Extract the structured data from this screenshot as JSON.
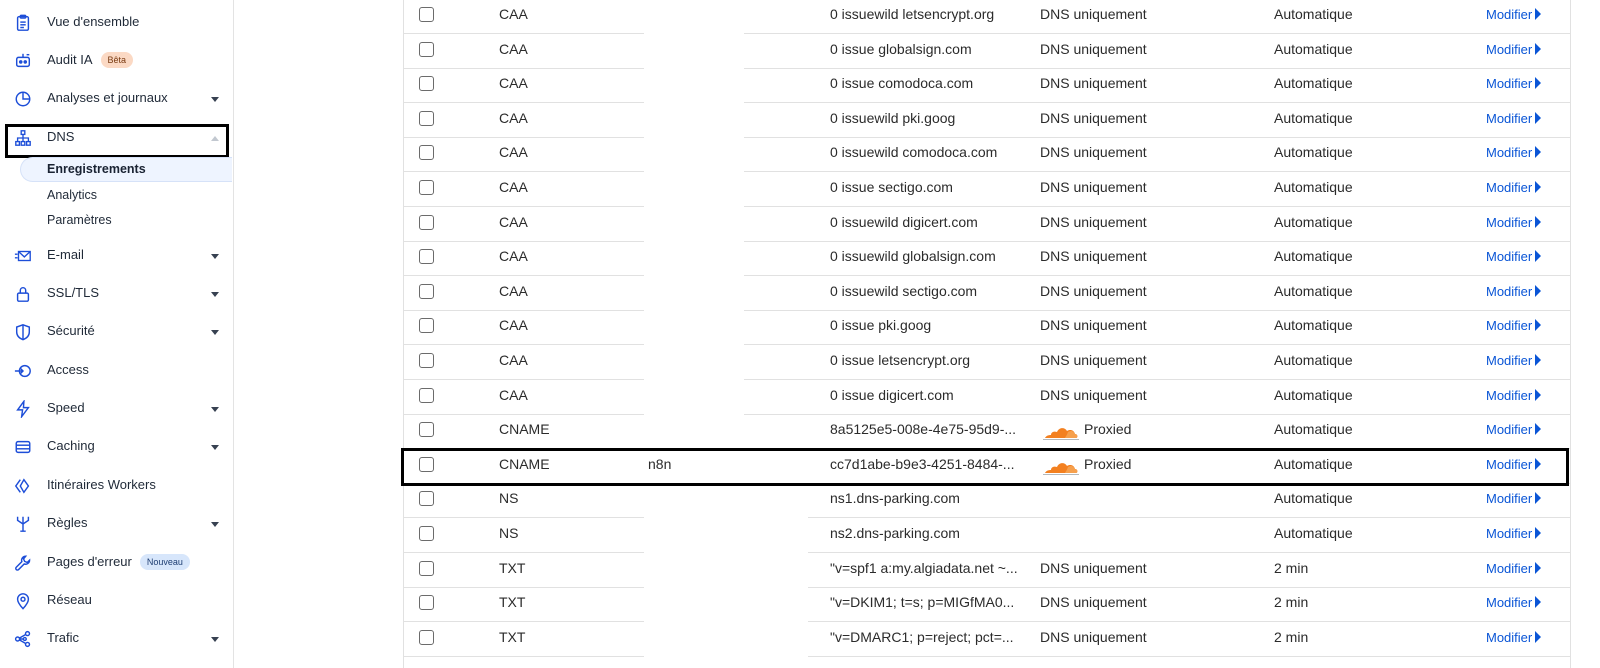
{
  "sidebar": {
    "items": [
      {
        "label": "Vue d'ensemble",
        "icon": "clipboard-icon"
      },
      {
        "label": "Audit IA",
        "icon": "robot-icon",
        "badge": "Bêta"
      },
      {
        "label": "Analyses et journaux",
        "icon": "pie-chart-icon"
      },
      {
        "label": "DNS",
        "icon": "network-tree-icon"
      },
      {
        "label": "E-mail",
        "icon": "envelope-icon"
      },
      {
        "label": "SSL/TLS",
        "icon": "lock-icon"
      },
      {
        "label": "Sécurité",
        "icon": "shield-icon"
      },
      {
        "label": "Access",
        "icon": "access-icon"
      },
      {
        "label": "Speed",
        "icon": "lightning-icon"
      },
      {
        "label": "Caching",
        "icon": "storage-icon"
      },
      {
        "label": "Itinéraires Workers",
        "icon": "workers-icon"
      },
      {
        "label": "Règles",
        "icon": "rules-fork-icon"
      },
      {
        "label": "Pages d'erreur",
        "icon": "wrench-icon",
        "badge": "Nouveau"
      },
      {
        "label": "Réseau",
        "icon": "location-pin-icon"
      },
      {
        "label": "Trafic",
        "icon": "traffic-nodes-icon"
      }
    ],
    "dns_sub": [
      {
        "label": "Enregistrements"
      },
      {
        "label": "Analytics"
      },
      {
        "label": "Paramètres"
      }
    ]
  },
  "table": {
    "edit_label": "Modifier",
    "rows": [
      {
        "type": "CAA",
        "name": "",
        "content": "0 issuewild letsencrypt.org",
        "proxy": "DNS uniquement",
        "ttl": "Automatique"
      },
      {
        "type": "CAA",
        "name": "",
        "content": "0 issue globalsign.com",
        "proxy": "DNS uniquement",
        "ttl": "Automatique"
      },
      {
        "type": "CAA",
        "name": "",
        "content": "0 issue comodoca.com",
        "proxy": "DNS uniquement",
        "ttl": "Automatique"
      },
      {
        "type": "CAA",
        "name": "",
        "content": "0 issuewild pki.goog",
        "proxy": "DNS uniquement",
        "ttl": "Automatique"
      },
      {
        "type": "CAA",
        "name": "",
        "content": "0 issuewild comodoca.com",
        "proxy": "DNS uniquement",
        "ttl": "Automatique"
      },
      {
        "type": "CAA",
        "name": "",
        "content": "0 issue sectigo.com",
        "proxy": "DNS uniquement",
        "ttl": "Automatique"
      },
      {
        "type": "CAA",
        "name": "",
        "content": "0 issuewild digicert.com",
        "proxy": "DNS uniquement",
        "ttl": "Automatique"
      },
      {
        "type": "CAA",
        "name": "",
        "content": "0 issuewild globalsign.com",
        "proxy": "DNS uniquement",
        "ttl": "Automatique"
      },
      {
        "type": "CAA",
        "name": "",
        "content": "0 issuewild sectigo.com",
        "proxy": "DNS uniquement",
        "ttl": "Automatique"
      },
      {
        "type": "CAA",
        "name": "",
        "content": "0 issue pki.goog",
        "proxy": "DNS uniquement",
        "ttl": "Automatique"
      },
      {
        "type": "CAA",
        "name": "",
        "content": "0 issue letsencrypt.org",
        "proxy": "DNS uniquement",
        "ttl": "Automatique"
      },
      {
        "type": "CAA",
        "name": "",
        "content": "0 issue digicert.com",
        "proxy": "DNS uniquement",
        "ttl": "Automatique"
      },
      {
        "type": "CNAME",
        "name": "",
        "content": "8a5125e5-008e-4e75-95d9-...",
        "proxy": "Proxied",
        "proxied": true,
        "ttl": "Automatique"
      },
      {
        "type": "CNAME",
        "name": "n8n",
        "content": "cc7d1abe-b9e3-4251-8484-...",
        "proxy": "Proxied",
        "proxied": true,
        "ttl": "Automatique",
        "highlighted": true
      },
      {
        "type": "NS",
        "name": "",
        "content": "ns1.dns-parking.com",
        "proxy": "",
        "ttl": "Automatique"
      },
      {
        "type": "NS",
        "name": "",
        "content": "ns2.dns-parking.com",
        "proxy": "",
        "ttl": "Automatique"
      },
      {
        "type": "TXT",
        "name": "",
        "content": "\"v=spf1 a:my.algiadata.net ~...",
        "proxy": "DNS uniquement",
        "ttl": "2 min"
      },
      {
        "type": "TXT",
        "name": "",
        "content": "\"v=DKIM1; t=s; p=MIGfMA0...",
        "proxy": "DNS uniquement",
        "ttl": "2 min"
      },
      {
        "type": "TXT",
        "name": "",
        "content": "\"v=DMARC1; p=reject; pct=...",
        "proxy": "DNS uniquement",
        "ttl": "2 min"
      }
    ]
  },
  "colors": {
    "link": "#0a55d6",
    "cloud": "#f38020",
    "beta_badge": "#fbd9c4",
    "new_badge": "#d7e6fb"
  }
}
